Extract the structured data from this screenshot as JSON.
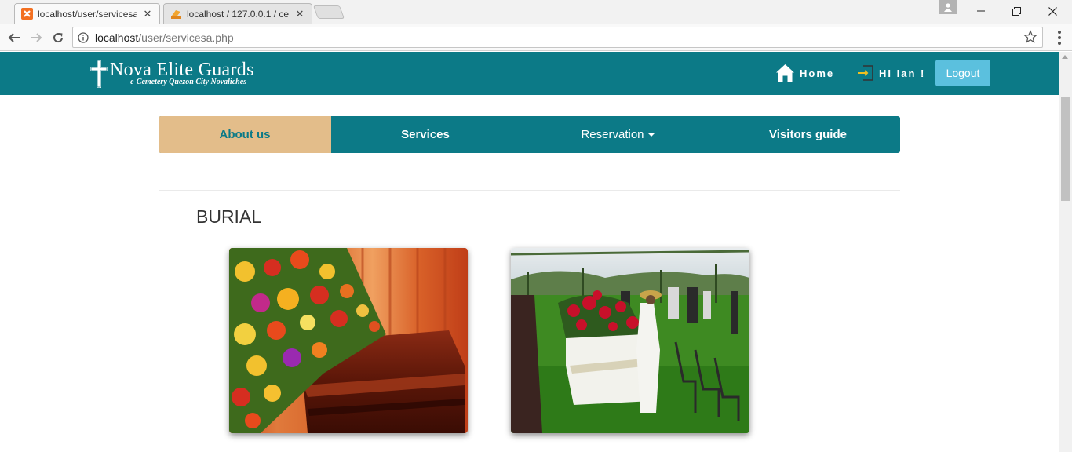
{
  "browser": {
    "tabs": [
      {
        "title": "localhost/user/servicesa.p",
        "close": "✕"
      },
      {
        "title": "localhost / 127.0.0.1 / ce",
        "close": "✕"
      }
    ],
    "address": {
      "host": "localhost",
      "path": "/user/servicesa.php"
    },
    "window_controls": {
      "minimize": "—",
      "restore": "❐",
      "close": "✕"
    }
  },
  "header": {
    "logo_title": "Nova Elite Guards",
    "logo_subtitle": "e-Cemetery Quezon City Novaliches",
    "home_label": "Home",
    "greeting": "HI Ian !",
    "logout_label": "Logout"
  },
  "subnav": {
    "items": [
      {
        "label": "About us"
      },
      {
        "label": "Services"
      },
      {
        "label": "Reservation"
      },
      {
        "label": "Visitors guide"
      }
    ]
  },
  "section": {
    "title": "BURIAL"
  },
  "colors": {
    "brand": "#0c7a87",
    "active_tab": "#e3bd8a",
    "logout": "#5bc0de"
  },
  "icons": [
    "home-icon",
    "sign-in-icon",
    "cross-icon",
    "info-icon",
    "star-icon"
  ]
}
